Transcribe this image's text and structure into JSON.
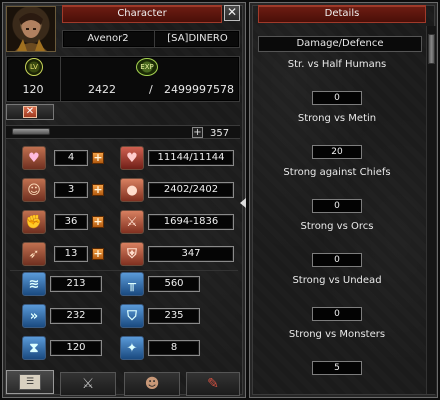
{
  "character_window": {
    "title": "Character",
    "close_symbol": "✕",
    "player_name": "Avenor2",
    "guild_name": "[SA]DINERO",
    "level_badge": "LV",
    "exp_badge": "EXP",
    "level": "120",
    "current_exp": "2422",
    "exp_separator": "/",
    "max_exp": "2499997578",
    "stat_points": "357",
    "plus_symbol": "+",
    "primary_stats": [
      {
        "icon": "vitality-icon",
        "value": "4",
        "derived_icon": "heart-icon",
        "derived_value": "11144/11144"
      },
      {
        "icon": "intelligence-icon",
        "value": "3",
        "derived_icon": "mana-icon",
        "derived_value": "2402/2402"
      },
      {
        "icon": "strength-icon",
        "value": "36",
        "derived_icon": "attack-icon",
        "derived_value": "1694-1836"
      },
      {
        "icon": "dexterity-icon",
        "value": "13",
        "derived_icon": "defense-shield-icon",
        "derived_value": "347"
      }
    ],
    "secondary_stats": [
      {
        "left_icon": "attack-speed-icon",
        "left_value": "213",
        "right_icon": "magic-attack-icon",
        "right_value": "560"
      },
      {
        "left_icon": "movement-speed-icon",
        "left_value": "232",
        "right_icon": "magic-defense-icon",
        "right_value": "235"
      },
      {
        "left_icon": "casting-speed-icon",
        "left_value": "120",
        "right_icon": "dodge-icon",
        "right_value": "8"
      }
    ],
    "tabs": [
      {
        "name": "tab-character",
        "icon": "character-sheet-icon"
      },
      {
        "name": "tab-skills",
        "icon": "crossed-swords-icon"
      },
      {
        "name": "tab-emotions",
        "icon": "emotion-icon"
      },
      {
        "name": "tab-quests",
        "icon": "quest-icon"
      }
    ]
  },
  "details_window": {
    "title": "Details",
    "section_header": "Damage/Defence",
    "rows": [
      {
        "label": "Str. vs Half Humans",
        "value": "0"
      },
      {
        "label": "Strong vs Metin",
        "value": "20"
      },
      {
        "label": "Strong against Chiefs",
        "value": "0"
      },
      {
        "label": "Strong vs Orcs",
        "value": "0"
      },
      {
        "label": "Strong vs Undead",
        "value": "0"
      },
      {
        "label": "Strong vs Monsters",
        "value": "5"
      }
    ]
  },
  "colors": {
    "title_red": "#5a150c",
    "plus_orange": "#e0801f",
    "level_green": "#c8d45a"
  }
}
